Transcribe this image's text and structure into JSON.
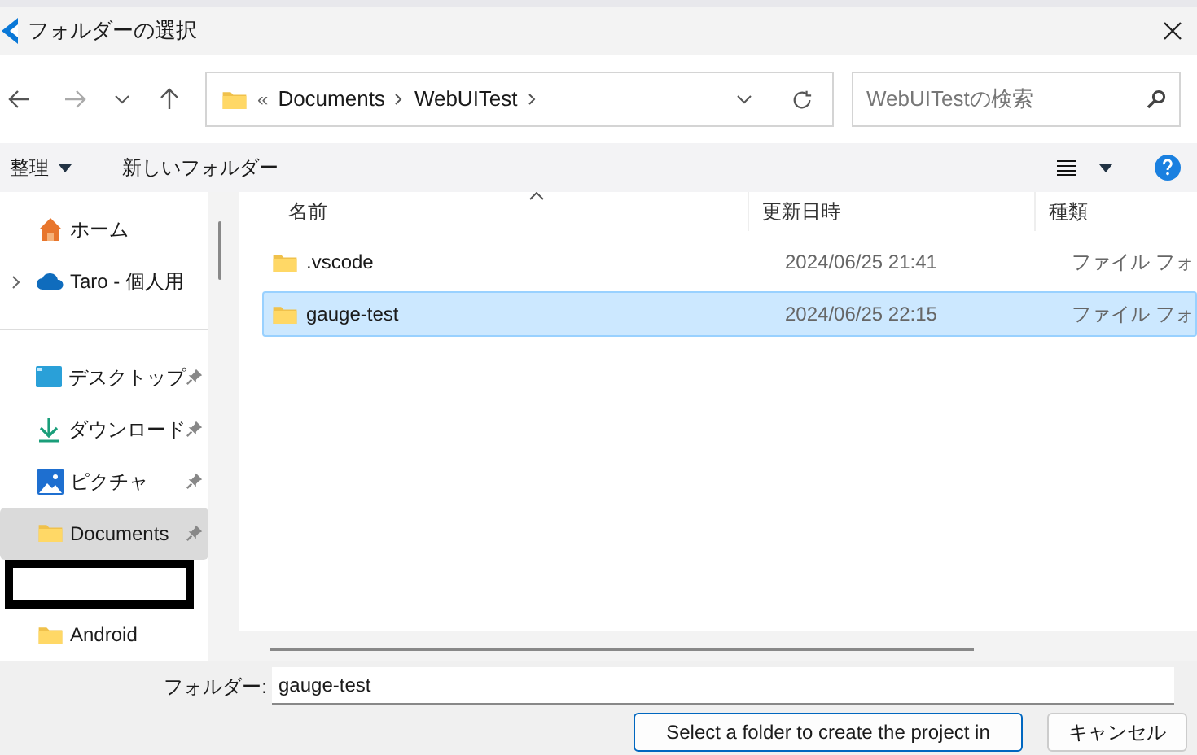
{
  "window": {
    "title": "フォルダーの選択"
  },
  "address_bar": {
    "overflow": "«",
    "segments": [
      "Documents",
      "WebUITest"
    ]
  },
  "search": {
    "placeholder": "WebUITestの検索"
  },
  "toolbar": {
    "organize": "整理",
    "new_folder": "新しいフォルダー"
  },
  "sidebar": {
    "items": [
      {
        "kind": "home",
        "label": "ホーム",
        "pinned": false,
        "selected": false,
        "expandable": false
      },
      {
        "kind": "cloud",
        "label": "Taro - 個人用",
        "pinned": false,
        "selected": false,
        "expandable": true
      },
      {
        "kind": "divider"
      },
      {
        "kind": "desktop",
        "label": "デスクトップ",
        "pinned": true,
        "selected": false,
        "expandable": false
      },
      {
        "kind": "download",
        "label": "ダウンロード",
        "pinned": true,
        "selected": false,
        "expandable": false
      },
      {
        "kind": "pictures",
        "label": "ピクチャ",
        "pinned": true,
        "selected": false,
        "expandable": false
      },
      {
        "kind": "folder",
        "label": "Documents",
        "pinned": true,
        "selected": true,
        "expandable": false
      },
      {
        "kind": "redacted"
      },
      {
        "kind": "folder",
        "label": "Android",
        "pinned": false,
        "selected": false,
        "expandable": false
      }
    ]
  },
  "table": {
    "columns": [
      "名前",
      "更新日時",
      "種類"
    ],
    "rows": [
      {
        "name": ".vscode",
        "modified": "2024/06/25 21:41",
        "type": "ファイル フォ",
        "selected": false
      },
      {
        "name": "gauge-test",
        "modified": "2024/06/25 22:15",
        "type": "ファイル フォ",
        "selected": true
      }
    ]
  },
  "footer": {
    "folder_label": "フォルダー:",
    "folder_value": "gauge-test",
    "buttons": [
      "Select a folder to create the project in",
      "キャンセル"
    ]
  }
}
